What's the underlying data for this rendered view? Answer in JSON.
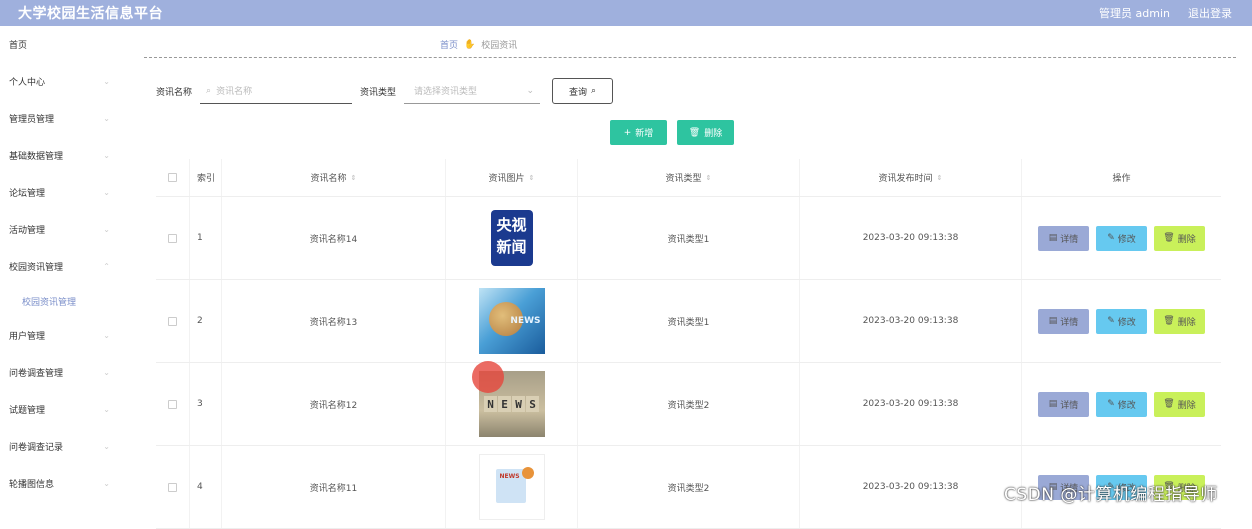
{
  "app": {
    "title": "大学校园生活信息平台",
    "user_label": "管理员 admin",
    "logout": "退出登录"
  },
  "sidebar": {
    "items": [
      {
        "label": "首页"
      },
      {
        "label": "个人中心"
      },
      {
        "label": "管理员管理"
      },
      {
        "label": "基础数据管理"
      },
      {
        "label": "论坛管理"
      },
      {
        "label": "活动管理"
      },
      {
        "label": "校园资讯管理"
      },
      {
        "label": "用户管理"
      },
      {
        "label": "问卷调查管理"
      },
      {
        "label": "试题管理"
      },
      {
        "label": "问卷调查记录"
      },
      {
        "label": "轮播图信息"
      }
    ],
    "sub_item": "校园资讯管理"
  },
  "breadcrumb": {
    "home": "首页",
    "current": "校园资讯"
  },
  "search": {
    "name_label": "资讯名称",
    "name_placeholder": "资讯名称",
    "type_label": "资讯类型",
    "type_placeholder": "请选择资讯类型",
    "query_button": "查询"
  },
  "actions": {
    "add": "新增",
    "delete": "删除"
  },
  "table": {
    "headers": {
      "index": "索引",
      "name": "资讯名称",
      "image": "资讯图片",
      "type": "资讯类型",
      "time": "资讯发布时间",
      "ops": "操作"
    },
    "op_labels": {
      "detail": "详情",
      "edit": "修改",
      "delete": "删除"
    },
    "rows": [
      {
        "index": "1",
        "name": "资讯名称14",
        "image": "cctv-news-logo",
        "type": "资讯类型1",
        "time": "2023-03-20 09:13:38"
      },
      {
        "index": "2",
        "name": "资讯名称13",
        "image": "news-globe-photo",
        "type": "资讯类型1",
        "time": "2023-03-20 09:13:38"
      },
      {
        "index": "3",
        "name": "资讯名称12",
        "image": "news-tiles-photo",
        "type": "资讯类型2",
        "time": "2023-03-20 09:13:38"
      },
      {
        "index": "4",
        "name": "资讯名称11",
        "image": "news-illustration",
        "type": "资讯类型2",
        "time": "2023-03-20 09:13:38"
      }
    ]
  },
  "thumbs": {
    "cctv_line1": "央视",
    "cctv_line2": "新闻",
    "globe_word": "NEWS",
    "tiles": [
      "N",
      "E",
      "W",
      "S"
    ],
    "doc_word": "NEWS"
  },
  "watermark": "CSDN @计算机编程指导师",
  "colors": {
    "header": "#9fb0dd",
    "add_button": "#2ec4a0",
    "detail": "#9aa9d6",
    "edit": "#66c9f0",
    "delete": "#c9f05a",
    "link": "#7a8ec9"
  }
}
